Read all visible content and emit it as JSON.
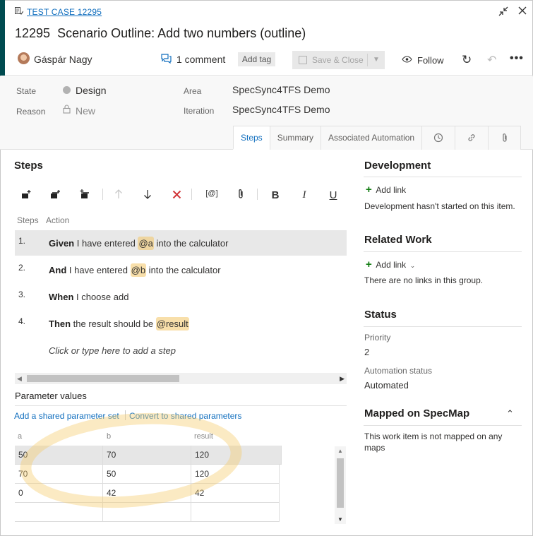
{
  "header": {
    "case_link": "TEST CASE 12295",
    "id": "12295",
    "title": "Scenario Outline: Add two numbers (outline)",
    "author": "Gáspár Nagy",
    "comments": "1 comment",
    "add_tag": "Add tag",
    "save_close": "Save & Close",
    "follow": "Follow"
  },
  "meta": {
    "state_label": "State",
    "state_value": "Design",
    "reason_label": "Reason",
    "reason_value": "New",
    "area_label": "Area",
    "area_value": "SpecSync4TFS Demo",
    "iteration_label": "Iteration",
    "iteration_value": "SpecSync4TFS Demo"
  },
  "tabs": [
    "Steps",
    "Summary",
    "Associated Automation"
  ],
  "steps": {
    "title": "Steps",
    "col_steps": "Steps",
    "col_action": "Action",
    "rows": [
      {
        "num": "1.",
        "kw": "Given",
        "pre": " I have entered ",
        "param": "@a",
        "post": " into the calculator"
      },
      {
        "num": "2.",
        "kw": "And",
        "pre": " I have entered ",
        "param": "@b",
        "post": " into the calculator"
      },
      {
        "num": "3.",
        "kw": "When",
        "pre": " I choose add",
        "param": "",
        "post": ""
      },
      {
        "num": "4.",
        "kw": "Then",
        "pre": " the result should be ",
        "param": "@result",
        "post": ""
      }
    ],
    "placeholder": "Click or type here to add a step"
  },
  "parameters": {
    "title": "Parameter values",
    "add_shared": "Add a shared parameter set",
    "convert": "Convert to shared parameters",
    "headers": [
      "a",
      "b",
      "result"
    ],
    "rows": [
      [
        "50",
        "70",
        "120"
      ],
      [
        "70",
        "50",
        "120"
      ],
      [
        "0",
        "42",
        "42"
      ],
      [
        "",
        "",
        ""
      ]
    ]
  },
  "right": {
    "development_title": "Development",
    "add_link": "Add link",
    "development_note": "Development hasn't started on this item.",
    "related_title": "Related Work",
    "related_add_link": "Add link",
    "related_note": "There are no links in this group.",
    "status_title": "Status",
    "priority_label": "Priority",
    "priority_value": "2",
    "automation_label": "Automation status",
    "automation_value": "Automated",
    "specmap_title": "Mapped on SpecMap",
    "specmap_note_1": "This work item is not mapped on any",
    "specmap_note_2": "maps"
  },
  "colors": {
    "accent": "#004b50",
    "link": "#106ebe",
    "highlight": "#f6cc70"
  },
  "icons": [
    "test-case-icon",
    "expand-icon",
    "close-icon",
    "comment-icon",
    "save-icon",
    "eye-icon",
    "refresh-icon",
    "undo-icon",
    "more-icon",
    "lock-icon",
    "history-icon",
    "link-icon",
    "attachment-icon"
  ]
}
